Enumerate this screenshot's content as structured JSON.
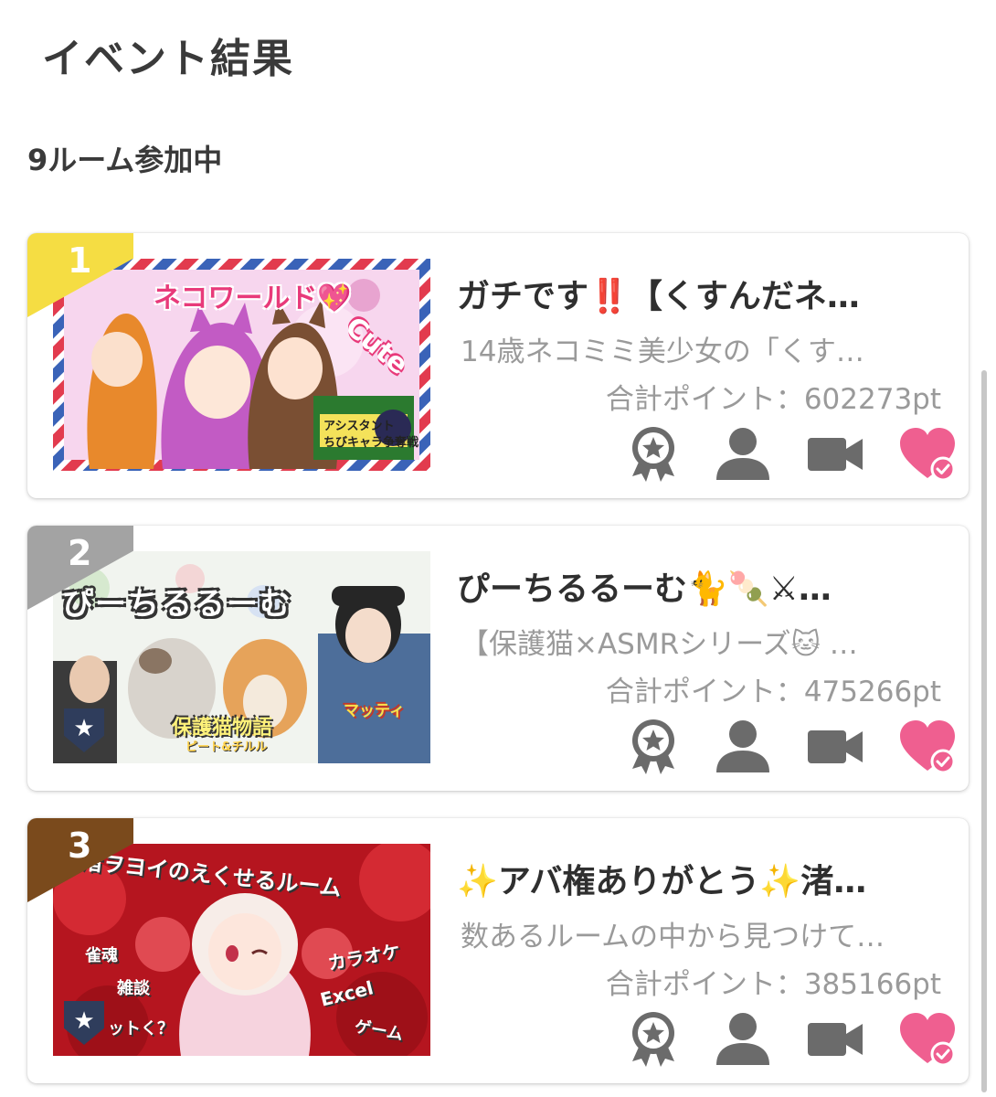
{
  "header": {
    "title": "イベント結果",
    "room_count": "9ルーム参加中"
  },
  "rooms": [
    {
      "rank": "1",
      "rank_color": "#f5dd43",
      "rank_text_color": "#ffffff",
      "title": "ガチです‼️【くすんだネ…",
      "description": "14歳ネコミミ美少女の「くす…",
      "points": "合計ポイント：602273pt",
      "thumb_texts": [
        "ネコワールド💖",
        "Cute",
        "アシスタント",
        "ちびキャラ争奪戦"
      ],
      "favorite_badge": false
    },
    {
      "rank": "2",
      "rank_color": "#a3a3a3",
      "rank_text_color": "#ffffff",
      "title": "ぴーちるるーむ🐈🍡⚔…",
      "description": "【保護猫×ASMRシリーズ🐱 …",
      "points": "合計ポイント：475266pt",
      "thumb_texts": [
        "ぴーちるるーむ",
        "保護猫物語",
        "ピート&チルル",
        "マッティ"
      ],
      "favorite_badge": true
    },
    {
      "rank": "3",
      "rank_color": "#7a4a1c",
      "rank_text_color": "#ffffff",
      "title": "✨アバ権ありがとう✨渚…",
      "description": "数あるルームの中から見つけて…",
      "points": "合計ポイント：385166pt",
      "thumb_texts": [
        "渚ヲヨイのえくせるルーム",
        "カラオケ",
        "Excel",
        "ゲーム",
        "雀魂",
        "雑談",
        "ットく？"
      ],
      "favorite_badge": true
    }
  ],
  "icons": [
    "award-icon",
    "person-icon",
    "video-camera-icon",
    "heart-check-icon"
  ],
  "colors": {
    "icon_gray": "#6b6b6b",
    "heart_pink": "#ef5f90",
    "text_dark": "#2f2f2f",
    "text_light": "#9a9a9a"
  }
}
